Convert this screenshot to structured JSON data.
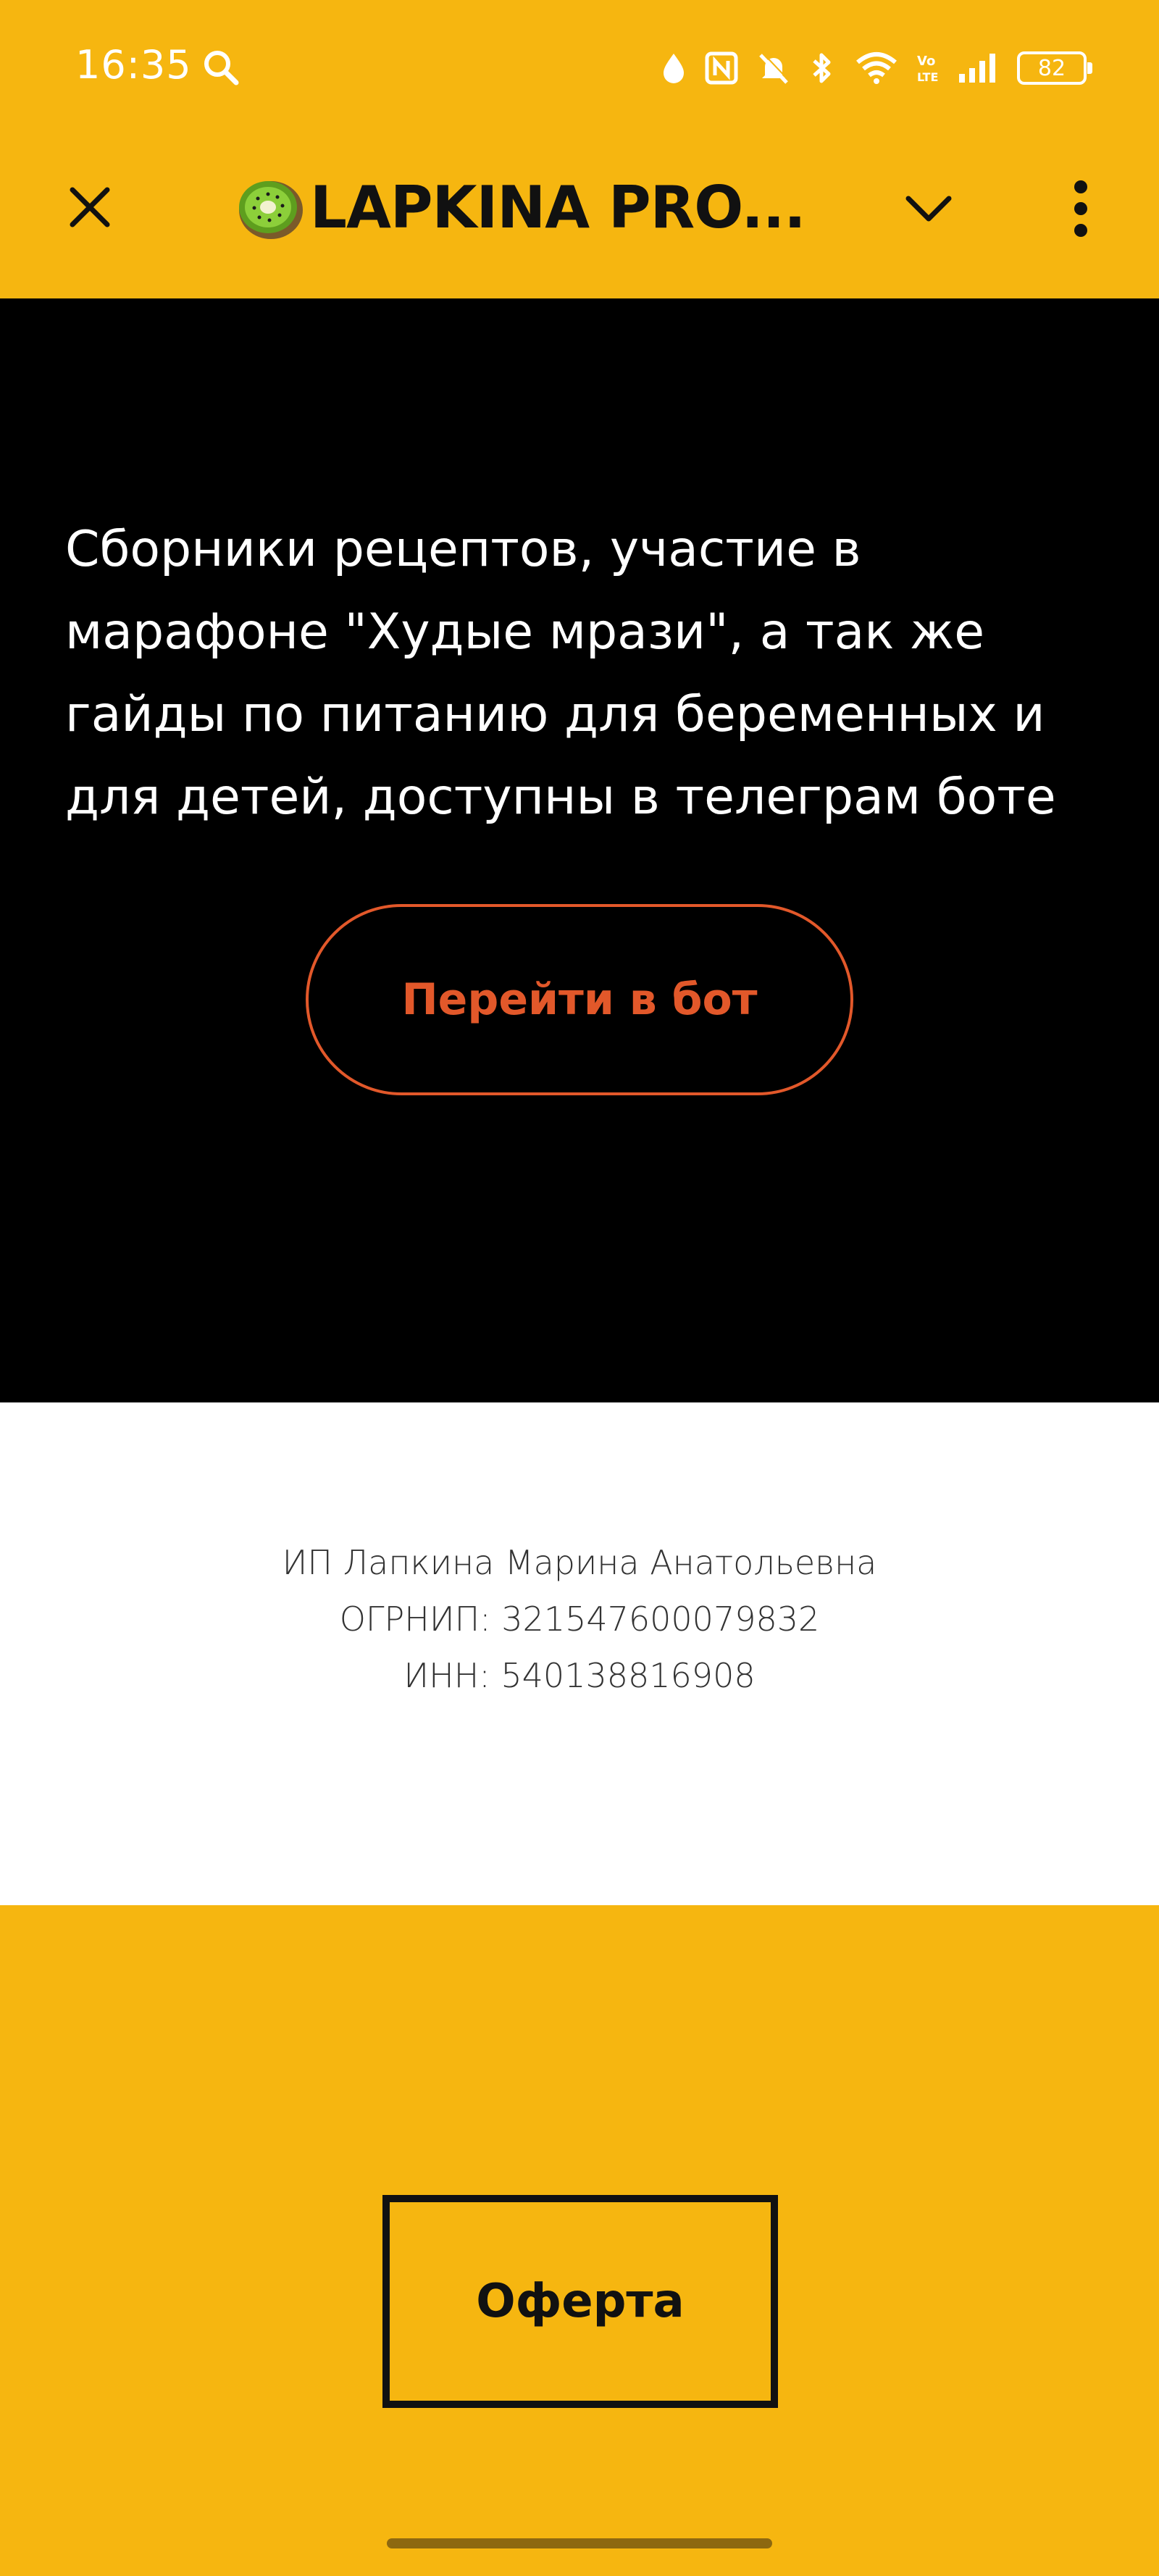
{
  "status_bar": {
    "time": "16:35",
    "battery_level": "82",
    "icons": [
      "search-icon",
      "location-drop-icon",
      "nfc-icon",
      "mute-icon",
      "bluetooth-icon",
      "wifi-icon",
      "volte-icon",
      "signal-icon",
      "battery-icon"
    ]
  },
  "header": {
    "title": "LAPKINA PRO...",
    "logo": "kiwi-logo",
    "close_icon": "close-icon",
    "expand_icon": "chevron-down-icon",
    "menu_icon": "more-vertical-icon"
  },
  "hero": {
    "lines": [
      "Сборники рецептов, участие в",
      "марафоне \"Худые мрази\", а так же",
      "гайды по питанию для беременных и",
      "для детей, доступны в телеграм боте"
    ],
    "button_label": "Перейти в бот"
  },
  "company": {
    "name": "ИП Лапкина Марина Анатольевна",
    "ogrnip": "ОГРНИП: 321547600079832",
    "inn": "ИНН: 540138816908"
  },
  "footer": {
    "button_label": "Оферта"
  },
  "colors": {
    "accent_yellow": "#F6B610",
    "hero_background": "#000000",
    "button_orange": "#E2582A"
  }
}
